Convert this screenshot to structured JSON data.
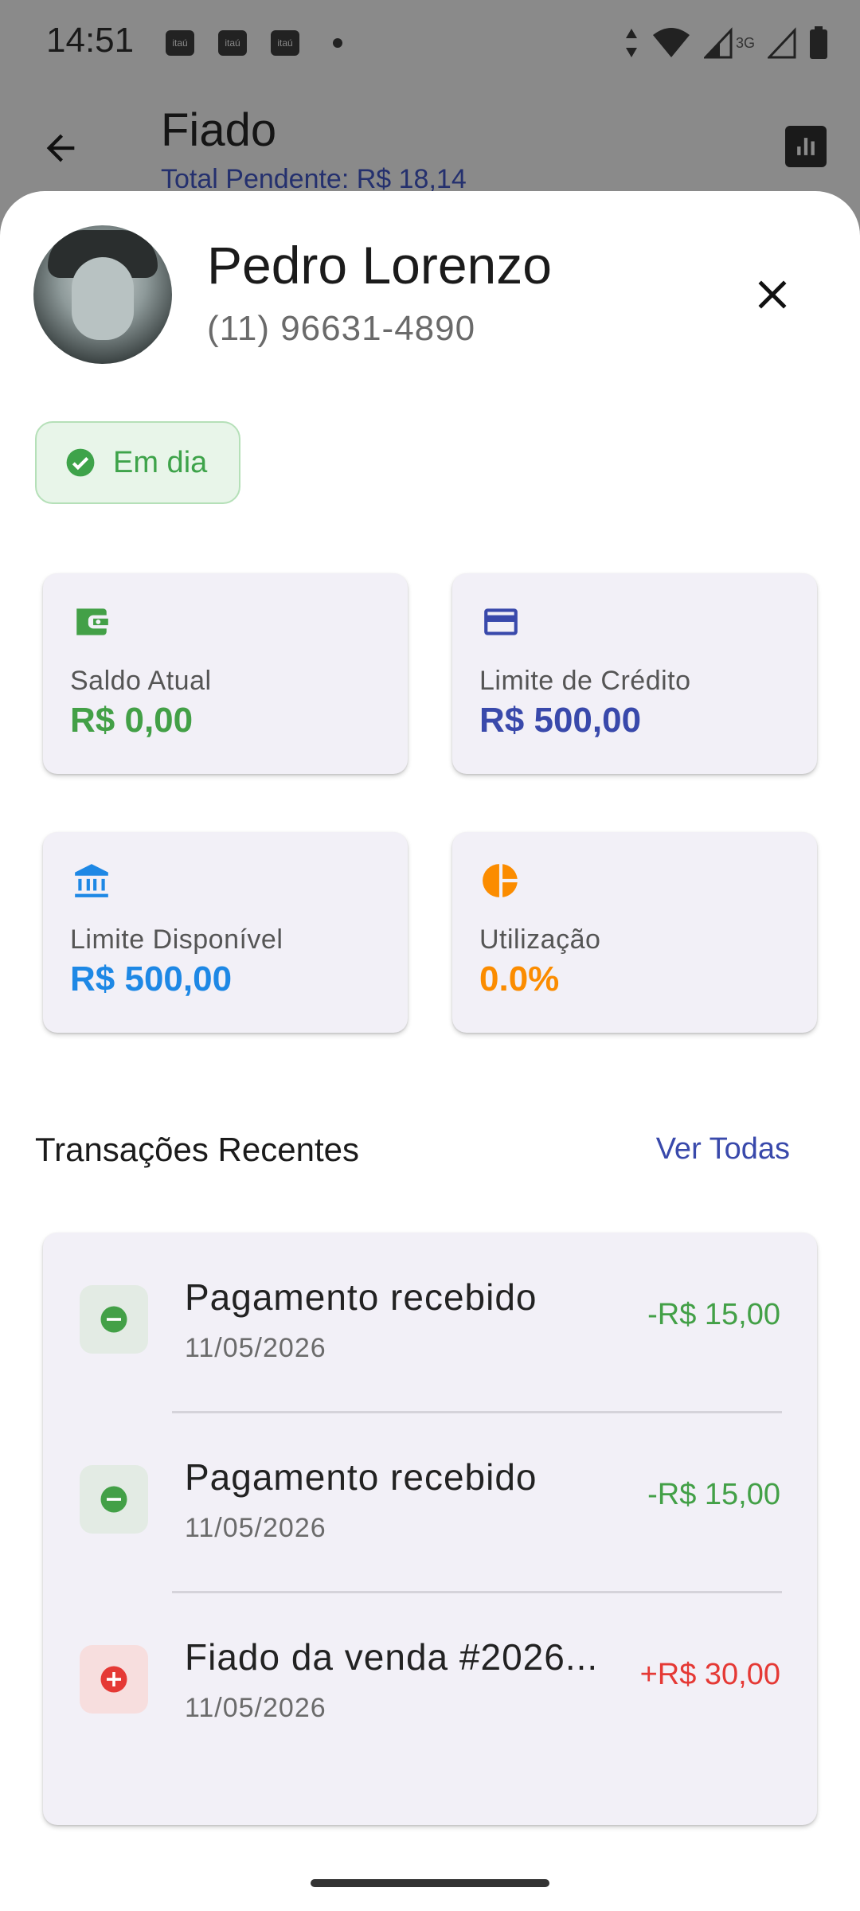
{
  "status_bar": {
    "time": "14:51",
    "notifications": [
      "itaú",
      "itaú",
      "itaú"
    ],
    "network_label": "3G"
  },
  "background_app": {
    "title": "Fiado",
    "subtitle": "Total Pendente: R$ 18,14"
  },
  "customer": {
    "name": "Pedro Lorenzo",
    "phone": "(11) 96631-4890",
    "status": "Em dia"
  },
  "cards": [
    {
      "label": "Saldo Atual",
      "value": "R$ 0,00",
      "icon": "wallet-icon",
      "color": "#43a047"
    },
    {
      "label": "Limite de Crédito",
      "value": "R$ 500,00",
      "icon": "credit-card-icon",
      "color": "#3949ab"
    },
    {
      "label": "Limite Disponível",
      "value": "R$ 500,00",
      "icon": "bank-icon",
      "color": "#1e88e5"
    },
    {
      "label": "Utilização",
      "value": "0.0%",
      "icon": "pie-chart-icon",
      "color": "#fb8c00"
    }
  ],
  "transactions_section": {
    "title": "Transações Recentes",
    "see_all": "Ver Todas"
  },
  "transactions": [
    {
      "title": "Pagamento recebido",
      "date": "11/05/2026",
      "amount": "-R$ 15,00",
      "type": "payment",
      "color": "#43a047"
    },
    {
      "title": "Pagamento recebido",
      "date": "11/05/2026",
      "amount": "-R$ 15,00",
      "type": "payment",
      "color": "#43a047"
    },
    {
      "title": "Fiado da venda #2026...",
      "date": "11/05/2026",
      "amount": "+R$ 30,00",
      "type": "credit",
      "color": "#e53935"
    }
  ]
}
